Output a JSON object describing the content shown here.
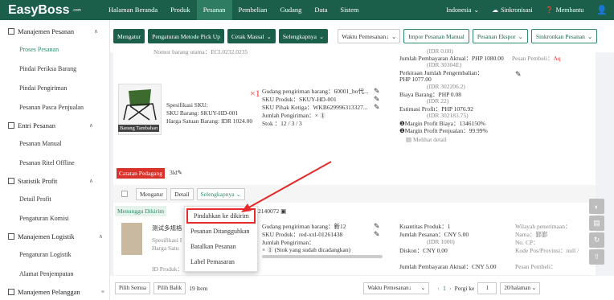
{
  "brand": {
    "logo": "EasyBoss",
    "com": ".com"
  },
  "nav": [
    "Halaman Beranda",
    "Produk",
    "Pesanan",
    "Pembelian",
    "Gudang",
    "Data",
    "Sistem"
  ],
  "nav_active": 2,
  "topright": {
    "lang": "Indonesia",
    "sync": "Sinkronisasi",
    "help": "Membantu"
  },
  "sidebar": {
    "g1": "Manajemen Pesanan",
    "items1": [
      "Proses Pesanan",
      "Pindai Periksa Barang",
      "Pindai Pengiriman",
      "Pesanan Pasca Penjualan"
    ],
    "g2": "Entri Pesanan",
    "items2": [
      "Pesanan Manual",
      "Pesanan Ritel Offline"
    ],
    "g3": "Statistik Profit",
    "items3": [
      "Detail Profit",
      "Pengaturan Komisi"
    ],
    "g4": "Manajemen Logistik",
    "items4": [
      "Pengaturan Logistik",
      "Alamat Penjemputan"
    ],
    "g5": "Manajemen Pelanggan"
  },
  "toolbar": {
    "b1": "Mengatur",
    "b2": "Pengaturan Metode Pick Up",
    "b3": "Cetak Massal",
    "b4": "Selengkapnya",
    "sel": "Waktu Pemesanan↓",
    "o1": "Impor Pesanan Manual",
    "o2": "Pesanan Ekspor",
    "o3": "Sinkronkan Pesanan"
  },
  "card1": {
    "nomor": "Nomor barang utama：ECL0232.0235",
    "qty": "×1",
    "gudang": "Gudang pengiriman barang：60001_bo代...",
    "sku": "SKU Produk：SKUY-HD-001",
    "pihak": "SKU Pihak Ketiga：WKB629996313327...",
    "jumlah": "Jumlah Pengiriman：×",
    "jumlah_n": "1",
    "stok": "Stok        ：12 / 3 / 3",
    "spec": "Spesifikasi SKU:",
    "skub": "SKU Barang:  SKUY-HD-001",
    "harga": "Harga Satuan Barang:  IDR 1024.00",
    "tag": "Barang Tambahan",
    "f0": "(IDR 0.00)",
    "f1": "Jumlah Pembayaran Aktual：PHP 1080.00",
    "f2": "(IDR 30304E)",
    "f3": "Perkiraan Jumlah Pengembalian：",
    "f4": "PHP 1077.00",
    "f5": "(IDR 302206.2)",
    "f6": "Biaya Barang：PHP 0.08",
    "f7": "(IDR 22)",
    "f8": "Estimasi Profit：PHP 1076.92",
    "f9": "(IDR 302183.75)",
    "f10": "❶Margin Profit Biaya：1346150%",
    "f11": "❶Margin Profit Penjualan：99.99%",
    "f12": "Melihat detail",
    "pesan": "Pesan Pembeli：",
    "pesan_v": "Aq"
  },
  "notes": {
    "tag": "Catatan Pedagang",
    "val": "3ld"
  },
  "card2head": {
    "mengatur": "Mengatur",
    "detail": "Detail",
    "selengkapnya": "Selengkapnya"
  },
  "card2": {
    "status": "Menunggu Dikirim",
    "order": "2140072",
    "prod": "测试多规格",
    "spec": "Spesifikasi I",
    "harga": "Harga Satu",
    "idp": "ID Produk：",
    "g": "Gudang pengiriman barang：新12",
    "s": "SKU Produk：red-xxl-01261438",
    "j": "Jumlah Pengiriman：",
    "jn": "1",
    "jt": "(Stok yang sudah dicadangkan)",
    "k1": "Kuantitas Produk：1",
    "k2": "Jumlah Pesanan：CNY 5.00",
    "k3": "(IDR 1000)",
    "k4": "Diskon：CNY 0.00",
    "k5": "Jumlah Pembayaran Aktual：CNY 5.00",
    "w1": "Wilayah penerimaan：",
    "w2": "Nama：鄞鄞",
    "w3": "No. CP：",
    "w4": "Kode Pos/Provinsi：null /",
    "w5": "Pesan Pembeli："
  },
  "dropdown": [
    "Pindahkan ke dikirim",
    "Pesanan Ditangguhkan",
    "Batalkan Pesanan",
    "Label Pemasaran"
  ],
  "footer": {
    "b1": "Pilih Semua",
    "b2": "Pilih Balik",
    "count": "19 Item",
    "sort": "Waktu Pemesanan↓",
    "page": "1",
    "goto": "Pergi ke",
    "goto_v": "1",
    "per": "20/halaman"
  },
  "colors": {
    "brand": "#1b5e4a",
    "accent": "#2e8a6b",
    "red": "#e52a2a"
  }
}
